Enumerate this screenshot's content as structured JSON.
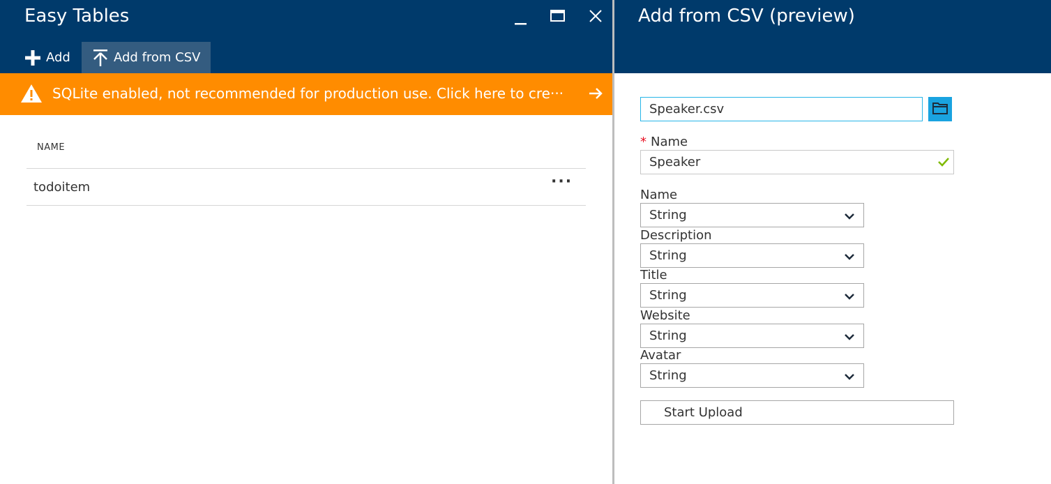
{
  "left_blade": {
    "title": "Easy Tables",
    "commands": {
      "add_label": "Add",
      "add_csv_label": "Add from CSV"
    },
    "warning": "SQLite enabled, not recommended for production use. Click here to cre···",
    "table": {
      "column_header": "NAME",
      "rows": [
        {
          "name": "todoitem",
          "more": "···"
        }
      ]
    }
  },
  "right_blade": {
    "title": "Add from CSV (preview)",
    "file_value": "Speaker.csv",
    "name_label": "Name",
    "name_required_mark": "*",
    "name_value": "Speaker",
    "columns": [
      {
        "label": "Name",
        "type": "String"
      },
      {
        "label": "Description",
        "type": "String"
      },
      {
        "label": "Title",
        "type": "String"
      },
      {
        "label": "Website",
        "type": "String"
      },
      {
        "label": "Avatar",
        "type": "String"
      }
    ],
    "upload_label": "Start Upload"
  },
  "colors": {
    "header_bg": "#003a6b",
    "active_command_bg": "#345c80",
    "warning_bg": "#ff8c00",
    "accent_blue": "#1aa3e0",
    "valid_green": "#7fba00",
    "required_red": "#e81123"
  },
  "icons": {
    "minimize": "minimize-icon",
    "maximize": "maximize-icon",
    "close": "close-icon",
    "add": "plus-icon",
    "upload": "upload-icon",
    "warning": "warning-icon",
    "arrow": "arrow-right-icon",
    "folder": "folder-icon",
    "check": "checkmark-icon",
    "chevron": "chevron-down-icon"
  }
}
